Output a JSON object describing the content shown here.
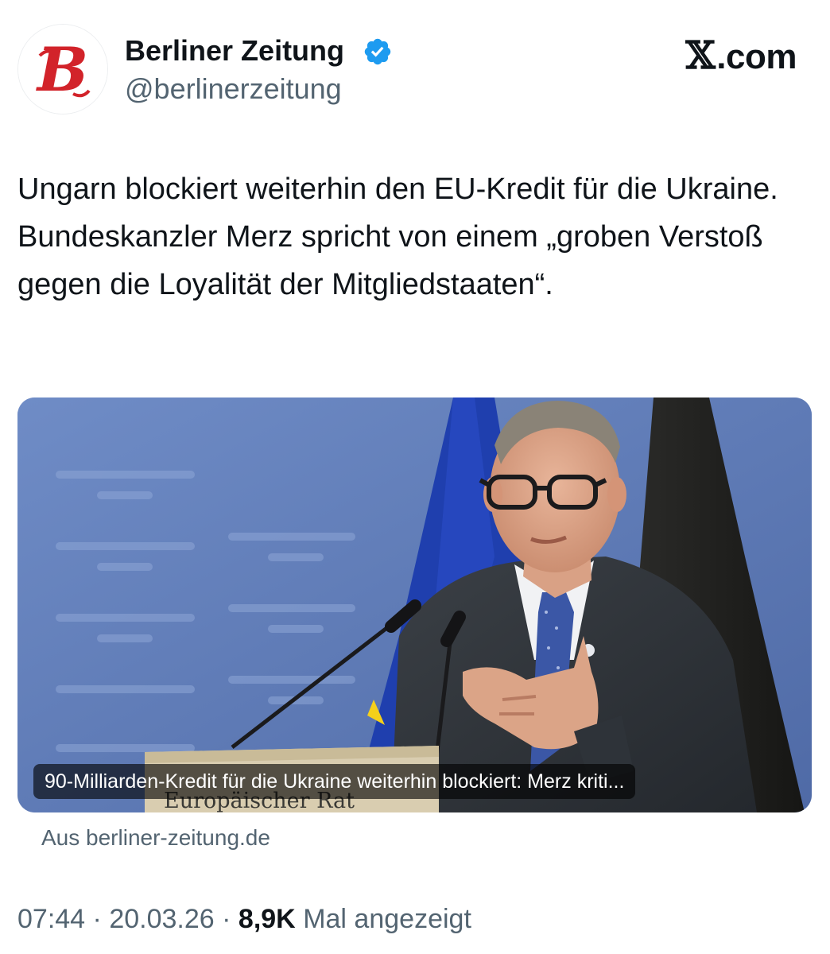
{
  "author": {
    "name": "Berliner Zeitung",
    "handle": "@berlinerzeitung",
    "avatar_letter": "B",
    "avatar_color": "#d2232a",
    "verified_color": "#1d9bf0"
  },
  "brand": {
    "label": ".com",
    "x_glyph": "𝕏"
  },
  "tweet": {
    "text": "Ungarn blockiert weiterhin den EU-Kredit für die Ukraine. Bundeskanzler Merz spricht von einem „groben Verstoß gegen die Loyalität der Mitgliedstaaten“."
  },
  "card": {
    "title": "90-Milliarden-Kredit für die Ukraine weiterhin blockiert: Merz kriti...",
    "source": "Aus berliner-zeitung.de",
    "lectern_text": "Europäischer Rat"
  },
  "meta": {
    "time": "07:44",
    "separator": "·",
    "date": "20.03.26",
    "views": "8,9K",
    "views_label": "Mal angezeigt"
  }
}
